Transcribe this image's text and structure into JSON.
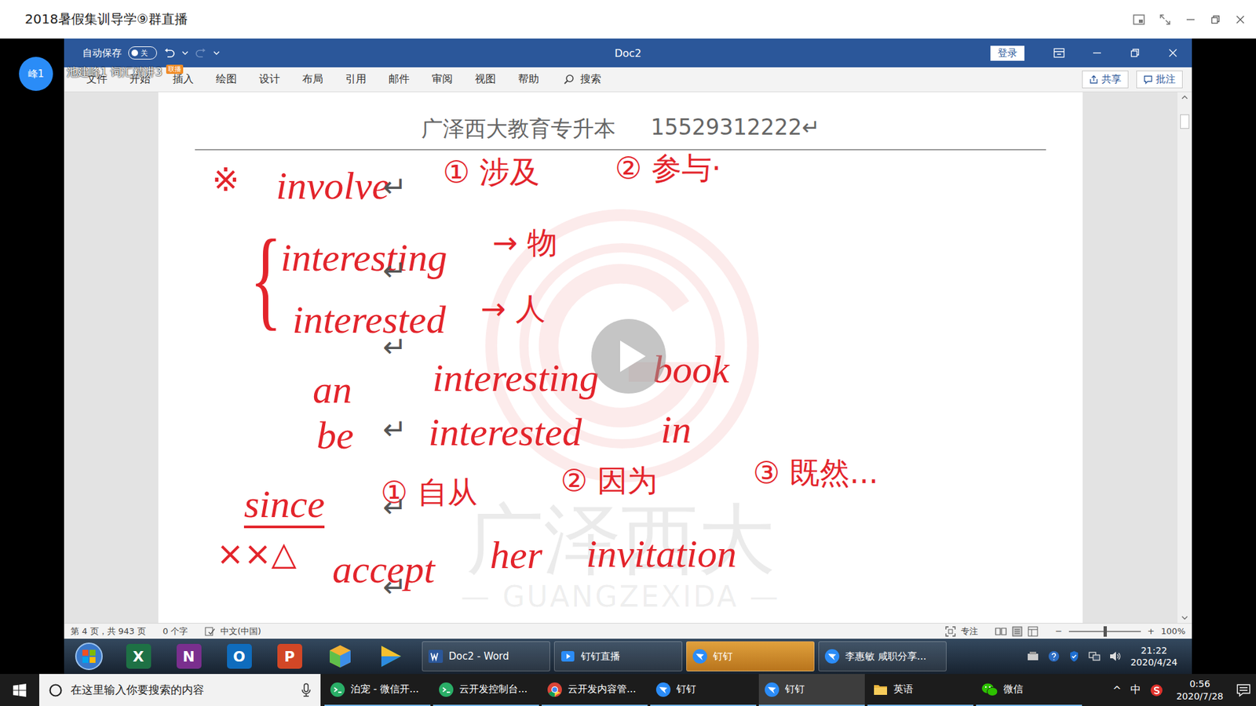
{
  "window": {
    "title": "2018暑假集训导学⑨群直播"
  },
  "presenter": {
    "avatar": "峰1"
  },
  "stream": {
    "title": "池建峰1 词汇精讲3",
    "badge": "联播"
  },
  "word": {
    "autosave": {
      "label": "自动保存",
      "state": "关",
      "on": false
    },
    "title": "Doc2",
    "login": "登录",
    "tabs": [
      {
        "label": "文件",
        "selected": false
      },
      {
        "label": "开始",
        "selected": false
      },
      {
        "label": "插入",
        "selected": false
      },
      {
        "label": "绘图",
        "selected": false
      },
      {
        "label": "设计",
        "selected": false
      },
      {
        "label": "布局",
        "selected": false
      },
      {
        "label": "引用",
        "selected": false
      },
      {
        "label": "邮件",
        "selected": false
      },
      {
        "label": "审阅",
        "selected": false
      },
      {
        "label": "视图",
        "selected": false
      },
      {
        "label": "帮助",
        "selected": false
      }
    ],
    "search": "搜索",
    "share": "共享",
    "comments": "批注",
    "header": {
      "name": "广泽西大教育专升本",
      "phone": "15529312222↵"
    },
    "watermark": {
      "name": "广泽西大",
      "latin": "— GUANGZEXIDA —"
    },
    "notes": [
      {
        "text": "※",
        "kind": "mark",
        "underlined": false
      },
      {
        "text": "involve",
        "kind": "latin",
        "underlined": false
      },
      {
        "text": "① 涉及",
        "kind": "cjk",
        "underlined": false
      },
      {
        "text": "② 参与·",
        "kind": "cjk",
        "underlined": false
      },
      {
        "text": "{",
        "kind": "brace",
        "underlined": false
      },
      {
        "text": "interesting",
        "kind": "latin",
        "underlined": false
      },
      {
        "text": "→ 物",
        "kind": "cjk",
        "underlined": false
      },
      {
        "text": "interested",
        "kind": "latin",
        "underlined": false
      },
      {
        "text": "→ 人",
        "kind": "cjk",
        "underlined": false
      },
      {
        "text": "an",
        "kind": "latin",
        "underlined": false
      },
      {
        "text": "interesting",
        "kind": "latin",
        "underlined": false
      },
      {
        "text": "book",
        "kind": "latin",
        "underlined": false
      },
      {
        "text": "be",
        "kind": "latin",
        "underlined": false
      },
      {
        "text": "interested",
        "kind": "latin",
        "underlined": false
      },
      {
        "text": "in",
        "kind": "latin",
        "underlined": false
      },
      {
        "text": "since",
        "kind": "latin",
        "underlined": true
      },
      {
        "text": "① 自从",
        "kind": "cjk",
        "underlined": false
      },
      {
        "text": "② 因为",
        "kind": "cjk",
        "underlined": false
      },
      {
        "text": "③ 既然...",
        "kind": "cjk",
        "underlined": false
      },
      {
        "text": "××△",
        "kind": "mark",
        "underlined": false
      },
      {
        "text": "accept",
        "kind": "latin",
        "underlined": false
      },
      {
        "text": "her",
        "kind": "latin",
        "underlined": false
      },
      {
        "text": "invitation",
        "kind": "latin",
        "underlined": false
      }
    ],
    "marks": [
      "↵",
      "↵",
      "↵",
      "↵",
      "↵",
      "↵"
    ],
    "status": {
      "page": "第 4 页，共 943 页",
      "words": "0 个字",
      "language": "中文(中国)",
      "focus": "专注",
      "zoom": {
        "minus": "−",
        "plus": "+",
        "level": 0.5,
        "reading": "100%"
      }
    }
  },
  "inner_taskbar": {
    "pinned": [
      {
        "kind": "excel",
        "label": "X"
      },
      {
        "kind": "onenote",
        "label": "N"
      },
      {
        "kind": "outlook",
        "label": "O"
      },
      {
        "kind": "powerpoint",
        "label": "P"
      },
      {
        "kind": "box"
      },
      {
        "kind": "player"
      }
    ],
    "windows": [
      {
        "label": "Doc2 - Word",
        "kind": "word",
        "selected": false
      },
      {
        "label": "钉钉直播",
        "kind": "live",
        "selected": false
      },
      {
        "label": "钉钉",
        "kind": "dingtalk",
        "selected": true
      },
      {
        "label": "李惠敏 咸职分享...",
        "kind": "dingtalk",
        "selected": false
      }
    ],
    "time": "21:22",
    "date": "2020/4/24"
  },
  "taskbar": {
    "search": {
      "placeholder": "在这里输入你要搜索的内容"
    },
    "items": [
      {
        "label": "泊宠 - 微信开...",
        "kind": "wechat-dev",
        "selected": false
      },
      {
        "label": "云开发控制台...",
        "kind": "wechat-dev",
        "selected": false
      },
      {
        "label": "云开发内容管...",
        "kind": "chrome",
        "selected": false
      },
      {
        "label": "钉钉",
        "kind": "dingtalk",
        "selected": false
      },
      {
        "label": "钉钉",
        "kind": "dingtalk",
        "selected": true
      },
      {
        "label": "英语",
        "kind": "folder",
        "selected": false
      },
      {
        "label": "微信",
        "kind": "wechat",
        "selected": false
      }
    ],
    "tray": {
      "chevron": "^",
      "ime": "中",
      "time": "0:56",
      "date": "2020/7/28"
    }
  }
}
